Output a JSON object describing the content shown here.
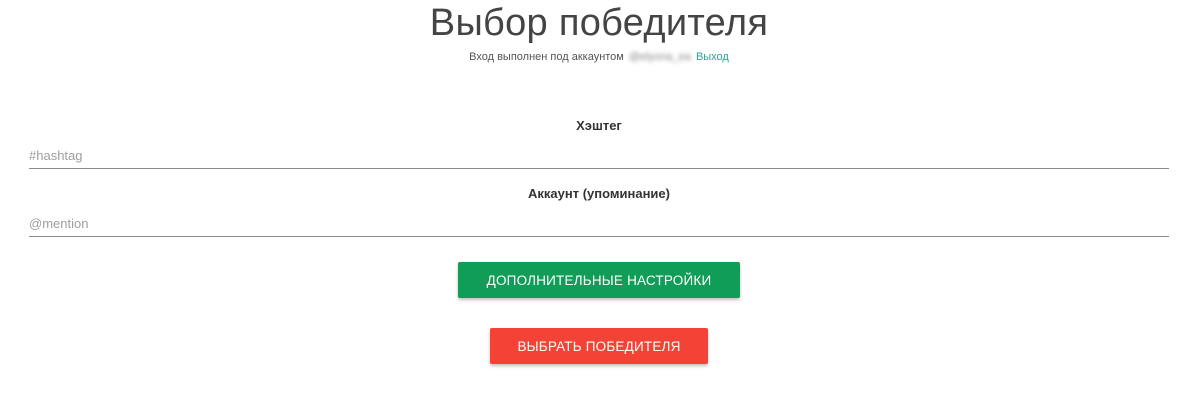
{
  "header": {
    "title": "Выбор победителя",
    "login_prefix": "Вход выполнен под аккаунтом",
    "username": "@elyona_ea",
    "logout_label": "Выход"
  },
  "form": {
    "hashtag": {
      "label": "Хэштег",
      "placeholder": "#hashtag",
      "value": ""
    },
    "mention": {
      "label": "Аккаунт (упоминание)",
      "placeholder": "@mention",
      "value": ""
    }
  },
  "buttons": {
    "settings_label": "Дополнительные настройки",
    "settings_color": "#0f9d58",
    "winner_label": "Выбрать победителя",
    "winner_color": "#f44336"
  },
  "colors": {
    "link": "#26a69a",
    "field_underline": "#8a8a8a"
  }
}
